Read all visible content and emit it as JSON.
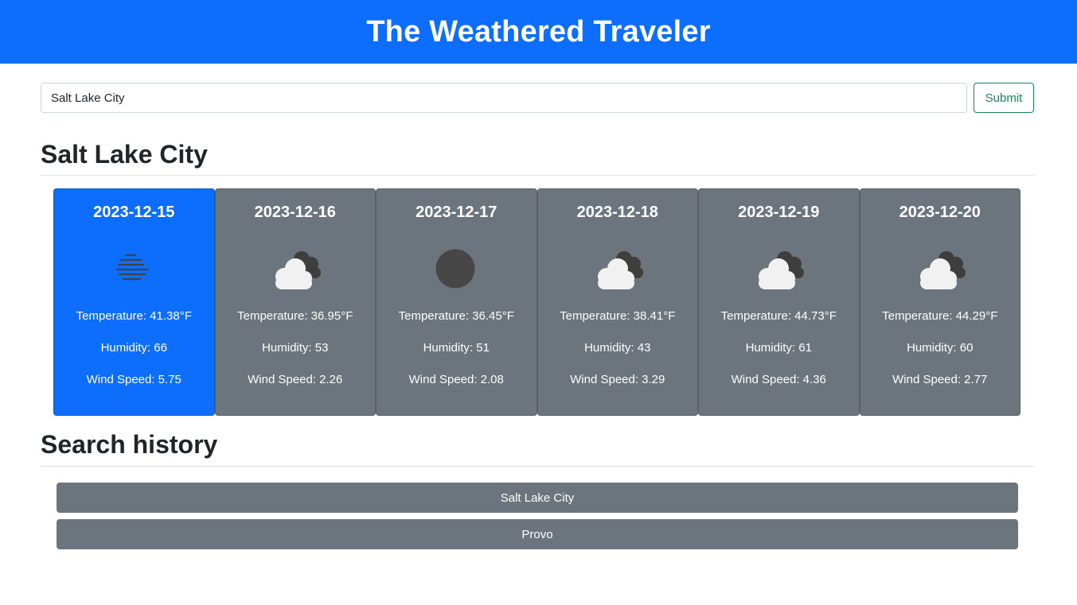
{
  "header": {
    "title": "The Weathered Traveler"
  },
  "search": {
    "value": "Salt Lake City",
    "submit_label": "Submit"
  },
  "forecast": {
    "city": "Salt Lake City",
    "days": [
      {
        "date": "2023-12-15",
        "icon": "mist-icon",
        "temperature": "Temperature: 41.38°F",
        "humidity": "Humidity: 66",
        "wind": "Wind Speed: 5.75",
        "active": true
      },
      {
        "date": "2023-12-16",
        "icon": "broken-clouds-icon",
        "temperature": "Temperature: 36.95°F",
        "humidity": "Humidity: 53",
        "wind": "Wind Speed: 2.26",
        "active": false
      },
      {
        "date": "2023-12-17",
        "icon": "clear-sky-icon",
        "temperature": "Temperature: 36.45°F",
        "humidity": "Humidity: 51",
        "wind": "Wind Speed: 2.08",
        "active": false
      },
      {
        "date": "2023-12-18",
        "icon": "broken-clouds-icon",
        "temperature": "Temperature: 38.41°F",
        "humidity": "Humidity: 43",
        "wind": "Wind Speed: 3.29",
        "active": false
      },
      {
        "date": "2023-12-19",
        "icon": "broken-clouds-icon",
        "temperature": "Temperature: 44.73°F",
        "humidity": "Humidity: 61",
        "wind": "Wind Speed: 4.36",
        "active": false
      },
      {
        "date": "2023-12-20",
        "icon": "broken-clouds-icon",
        "temperature": "Temperature: 44.29°F",
        "humidity": "Humidity: 60",
        "wind": "Wind Speed: 2.77",
        "active": false
      }
    ]
  },
  "history": {
    "title": "Search history",
    "items": [
      "Salt Lake City",
      "Provo"
    ]
  },
  "colors": {
    "primary": "#0d6efd",
    "secondary": "#6c757d",
    "success": "#198754"
  }
}
